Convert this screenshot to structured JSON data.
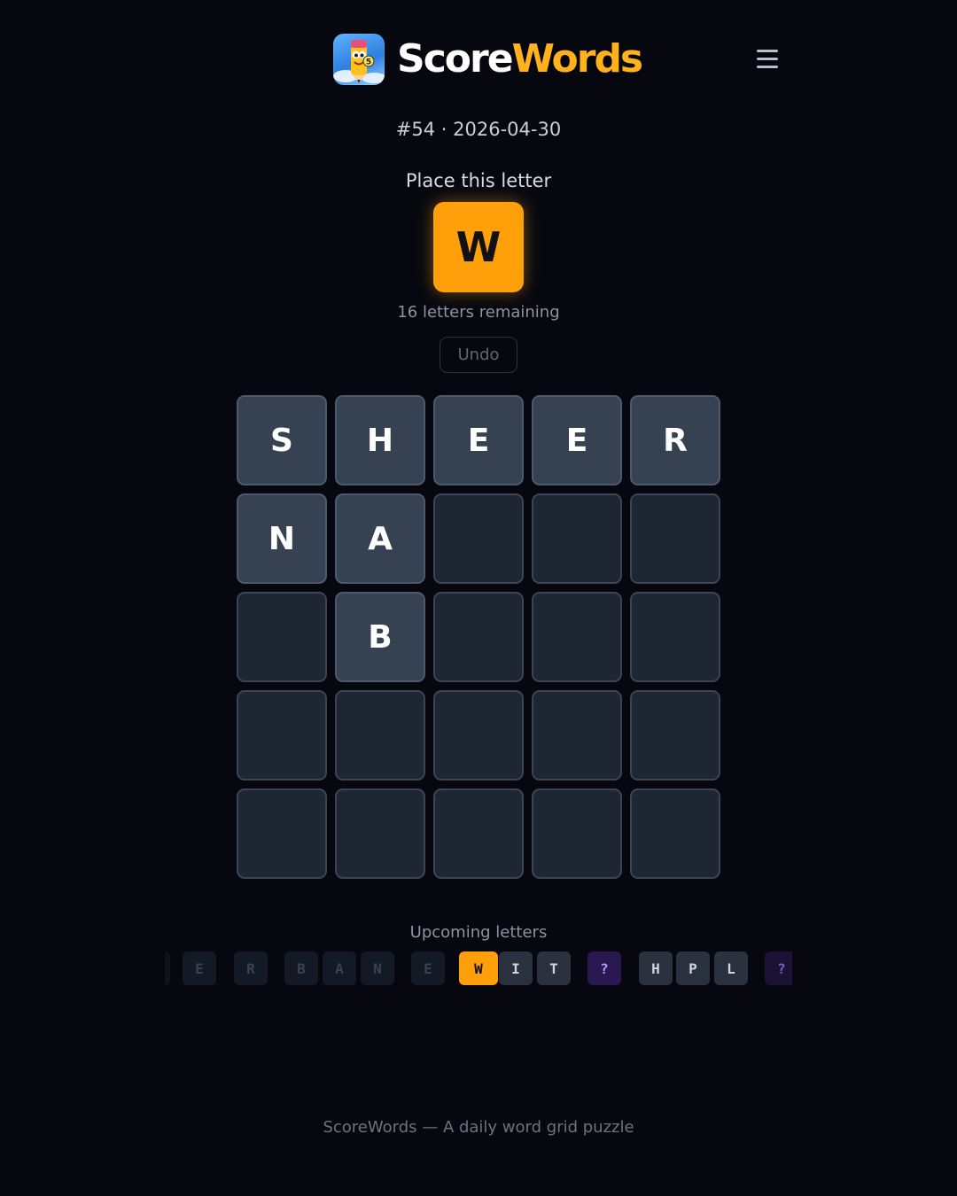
{
  "header": {
    "brand_part1": "Score",
    "brand_part2": "Words",
    "icon": "pencil-mascot-icon",
    "menu_icon": "hamburger-menu-icon"
  },
  "puzzle": {
    "meta": "#54 · 2026-04-30",
    "place_label": "Place this letter",
    "current_letter": "W",
    "remaining": "16 letters remaining",
    "undo_label": "Undo"
  },
  "grid": {
    "rows": [
      [
        "S",
        "H",
        "E",
        "E",
        "R"
      ],
      [
        "N",
        "A",
        "",
        "",
        ""
      ],
      [
        "",
        "B",
        "",
        "",
        ""
      ],
      [
        "",
        "",
        "",
        "",
        ""
      ],
      [
        "",
        "",
        "",
        "",
        ""
      ]
    ]
  },
  "upcoming": {
    "label": "Upcoming letters",
    "past": [
      "E",
      "R",
      "B",
      "A",
      "N",
      "E"
    ],
    "current": "W",
    "next": [
      "I",
      "T",
      "?",
      "H",
      "P",
      "L",
      "?"
    ]
  },
  "footer": {
    "text": "ScoreWords — A daily word grid puzzle"
  },
  "colors": {
    "background": "#07080f",
    "accent": "#ff9f0a",
    "brand_accent": "#ffb21c",
    "wildcard": "#2a1850"
  }
}
